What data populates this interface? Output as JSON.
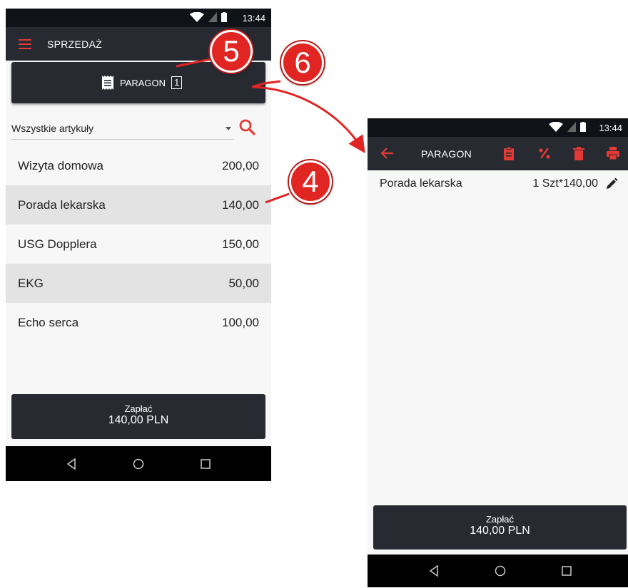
{
  "status": {
    "time": "13:44"
  },
  "left": {
    "title": "SPRZEDAŻ",
    "paragon_label": "PARAGON",
    "paragon_count": "1",
    "filter_label": "Wszystkie artykuły",
    "items": [
      {
        "name": "Wizyta domowa",
        "price": "200,00"
      },
      {
        "name": "Porada lekarska",
        "price": "140,00"
      },
      {
        "name": "USG Dopplera",
        "price": "150,00"
      },
      {
        "name": "EKG",
        "price": "50,00"
      },
      {
        "name": "Echo serca",
        "price": "100,00"
      }
    ],
    "pay_label": "Zapłać",
    "pay_amount": "140,00 PLN"
  },
  "right": {
    "title": "PARAGON",
    "line_name": "Porada lekarska",
    "line_qty": "1 Szt*140,00",
    "pay_label": "Zapłać",
    "pay_amount": "140,00 PLN"
  },
  "callouts": {
    "c4": "4",
    "c5": "5",
    "c6": "6"
  },
  "colors": {
    "accent": "#e53935",
    "toolbar": "#272b31",
    "statusbar": "#0f1216",
    "callout": "#e02523"
  },
  "icons": [
    "menu-icon",
    "receipt-icon",
    "search-icon",
    "back-arrow-icon",
    "clipboard-icon",
    "percent-icon",
    "trash-icon",
    "print-icon",
    "edit-pencil-icon",
    "wifi-icon",
    "battery-icon",
    "nav-back-icon",
    "nav-home-icon",
    "nav-recents-icon"
  ]
}
